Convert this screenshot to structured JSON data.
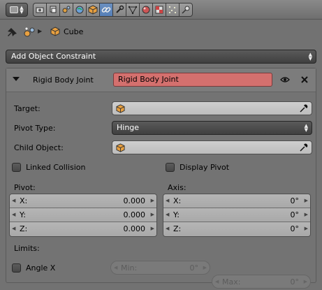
{
  "header": {
    "tabs": [
      {
        "icon": "render-icon",
        "active": false
      },
      {
        "icon": "render-layers-icon",
        "active": false
      },
      {
        "icon": "scene-icon",
        "active": false
      },
      {
        "icon": "world-icon",
        "active": false
      },
      {
        "icon": "object-icon",
        "active": false
      },
      {
        "icon": "constraint-icon",
        "active": true
      },
      {
        "icon": "modifier-wrench-icon",
        "active": false
      },
      {
        "icon": "object-data-mesh-icon",
        "active": false
      },
      {
        "icon": "material-icon",
        "active": false
      },
      {
        "icon": "texture-icon",
        "active": false
      },
      {
        "icon": "particles-icon",
        "active": false
      },
      {
        "icon": "physics-icon",
        "active": false
      }
    ]
  },
  "breadcrumb": {
    "object_name": "Cube"
  },
  "add_constraint": {
    "label": "Add Object Constraint"
  },
  "constraint": {
    "type_label": "Rigid Body Joint",
    "name": "Rigid Body Joint",
    "target_label": "Target:",
    "target_value": "",
    "pivot_type_label": "Pivot Type:",
    "pivot_type_value": "Hinge",
    "child_object_label": "Child Object:",
    "child_object_value": "",
    "linked_collision_label": "Linked Collision",
    "linked_collision_checked": false,
    "display_pivot_label": "Display Pivot",
    "display_pivot_checked": false,
    "pivot": {
      "heading": "Pivot:",
      "x_label": "X:",
      "x_value": "0.000",
      "y_label": "Y:",
      "y_value": "0.000",
      "z_label": "Z:",
      "z_value": "0.000"
    },
    "axis": {
      "heading": "Axis:",
      "x_label": "X:",
      "x_value": "0°",
      "y_label": "Y:",
      "y_value": "0°",
      "z_label": "Z:",
      "z_value": "0°"
    },
    "limits": {
      "heading": "Limits:",
      "angle_x_label": "Angle X",
      "angle_x_checked": false,
      "min_label": "Min:",
      "min_value": "0°",
      "max_label": "Max:",
      "max_value": "0°"
    }
  },
  "colors": {
    "background": "#727272",
    "name_field": "#d4706e",
    "active_tab": "#5680b8"
  }
}
